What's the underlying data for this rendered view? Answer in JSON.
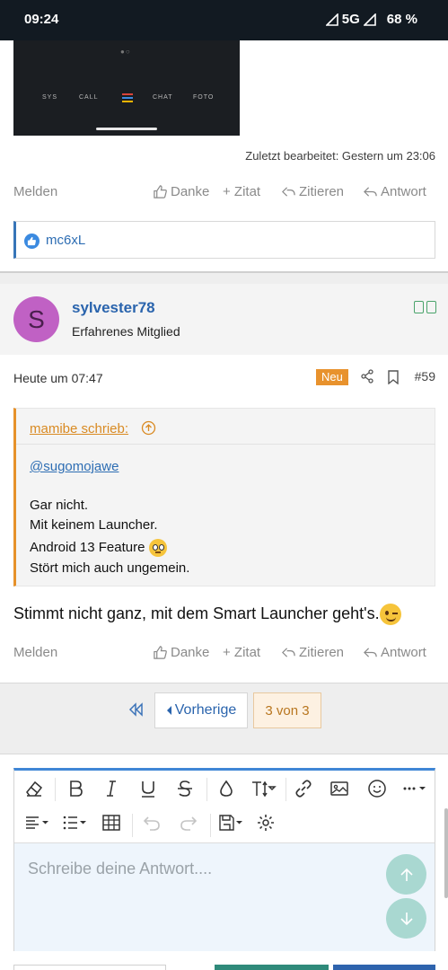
{
  "status_bar": {
    "time": "09:24",
    "network": "5G",
    "battery": "68 %"
  },
  "embedded_image": {
    "labels": [
      "SYS",
      "CALL",
      "CHAT",
      "FOTO"
    ],
    "bar_colors": [
      "#d9443a",
      "#3b8ae0",
      "#f4b400"
    ]
  },
  "post1": {
    "edited_text": "Zuletzt bearbeitet: Gestern um 23:06",
    "actions": {
      "report": "Melden",
      "like": "Danke",
      "quote": "+ Zitat",
      "cite": "Zitieren",
      "reply": "Antwort"
    },
    "reactions": {
      "user": "mc6xL"
    }
  },
  "post2": {
    "author": {
      "initial": "S",
      "name": "sylvester78",
      "title": "Erfahrenes Mitglied",
      "avatar_color": "#c061c4"
    },
    "date": "Heute um 07:47",
    "badge": "Neu",
    "number": "#59",
    "quote": {
      "header": "mamibe schrieb:",
      "mention": "@sugomojawe",
      "lines": [
        "Gar nicht.",
        "Mit keinem Launcher.",
        "Android 13 Feature",
        "Stört mich auch ungemein."
      ],
      "emoji": "face-with-rolling-eyes"
    },
    "body": "Stimmt nicht ganz, mit dem Smart Launcher geht's.",
    "body_emoji": "winking-face",
    "actions": {
      "report": "Melden",
      "like": "Danke",
      "quote": "+ Zitat",
      "cite": "Zitieren",
      "reply": "Antwort"
    }
  },
  "pagination": {
    "prev": "Vorherige",
    "current": "3 von 3"
  },
  "editor": {
    "placeholder": "Schreibe deine Antwort....",
    "accent": "#3f86d6",
    "toolbar_row1": [
      "eraser-icon",
      "bold-icon",
      "italic-icon",
      "underline-icon",
      "strikethrough-icon",
      "color-icon",
      "text-size-icon",
      "link-icon",
      "image-icon",
      "smiley-icon",
      "more-icon"
    ],
    "toolbar_row2": [
      "align-icon",
      "list-icon",
      "table-icon",
      "undo-icon",
      "redo-icon",
      "save-draft-icon",
      "settings-icon"
    ]
  }
}
